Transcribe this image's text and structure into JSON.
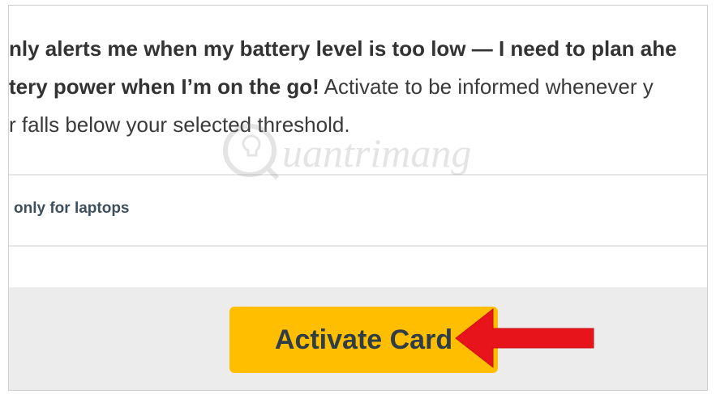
{
  "description": {
    "line1_bold": "nly alerts me when my battery level is too low — I need to plan ahe",
    "line2_bold": "tery power when I’m on the go!",
    "line2_rest": " Activate to be informed whenever y",
    "line3": "r falls below your selected threshold."
  },
  "compatibility_note": "only for laptops",
  "activate_button_label": "Activate Card",
  "watermark_text": "uantrimang",
  "colors": {
    "button": "#ffbf00",
    "arrow": "#e8141b",
    "footer": "#ececec"
  },
  "icons": {
    "arrow": "red-arrow-pointing-left",
    "watermark_logo": "lightbulb-q-logo"
  }
}
